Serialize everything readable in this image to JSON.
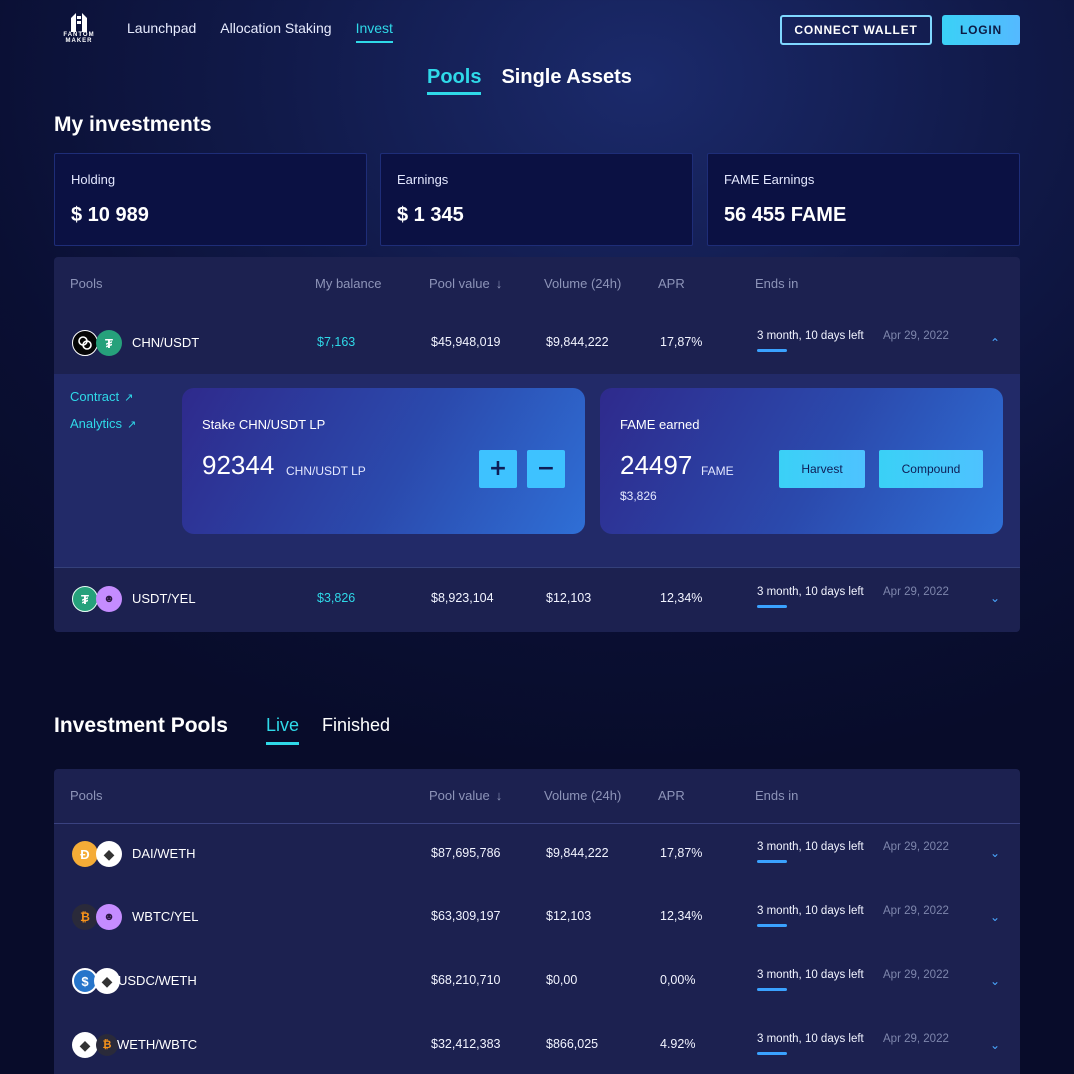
{
  "header": {
    "logo_text": "FANTOM MAKER",
    "nav": [
      "Launchpad",
      "Allocation Staking",
      "Invest"
    ],
    "connect_label": "CONNECT WALLET",
    "login_label": "LOGIN"
  },
  "main_tabs": [
    "Pools",
    "Single Assets"
  ],
  "my_investments": {
    "title": "My investments",
    "stats": [
      {
        "label": "Holding",
        "value": "$ 10 989"
      },
      {
        "label": "Earnings",
        "value": "$ 1 345"
      },
      {
        "label": "FAME Earnings",
        "value": "56 455 FAME"
      }
    ],
    "headers": {
      "pools": "Pools",
      "balance": "My balance",
      "value": "Pool value",
      "volume": "Volume (24h)",
      "apr": "APR",
      "ends": "Ends in"
    },
    "rows": [
      {
        "pair": "CHN/USDT",
        "balance": "$7,163",
        "value": "$45,948,019",
        "volume": "$9,844,222",
        "apr": "17,87%",
        "ends": "3 month, 10 days left",
        "date": "Apr 29, 2022"
      },
      {
        "pair": "USDT/YEL",
        "balance": "$3,826",
        "value": "$8,923,104",
        "volume": "$12,103",
        "apr": "12,34%",
        "ends": "3 month, 10 days left",
        "date": "Apr 29, 2022"
      }
    ],
    "expanded": {
      "contract": "Contract",
      "analytics": "Analytics",
      "stake_label": "Stake CHN/USDT LP",
      "stake_value": "92344",
      "stake_unit": "CHN/USDT LP",
      "plus": "+",
      "minus": "−",
      "fame_label": "FAME earned",
      "fame_value": "24497",
      "fame_unit": "FAME",
      "fame_usd": "$3,826",
      "harvest": "Harvest",
      "compound": "Compound"
    }
  },
  "investment_pools": {
    "title": "Investment Pools",
    "tabs": [
      "Live",
      "Finished"
    ],
    "headers": {
      "pools": "Pools",
      "value": "Pool value",
      "volume": "Volume (24h)",
      "apr": "APR",
      "ends": "Ends in"
    },
    "rows": [
      {
        "pair": "DAI/WETH",
        "value": "$87,695,786",
        "volume": "$9,844,222",
        "apr": "17,87%",
        "ends": "3 month, 10 days left",
        "date": "Apr 29, 2022"
      },
      {
        "pair": "WBTC/YEL",
        "value": "$63,309,197",
        "volume": "$12,103",
        "apr": "12,34%",
        "ends": "3 month, 10 days left",
        "date": "Apr 29, 2022"
      },
      {
        "pair": "USDC/WETH",
        "value": "$68,210,710",
        "volume": "$0,00",
        "apr": "0,00%",
        "ends": "3 month, 10 days left",
        "date": "Apr 29, 2022"
      },
      {
        "pair": "WETH/WBTC",
        "value": "$32,412,383",
        "volume": "$866,025",
        "apr": "4.92%",
        "ends": "3 month, 10 days left",
        "date": "Apr 29, 2022"
      }
    ]
  },
  "colors": {
    "accent": "#2fd9e8",
    "button": "#3ec2ff",
    "background": "#0a0f33",
    "panel": "#1c2150"
  }
}
